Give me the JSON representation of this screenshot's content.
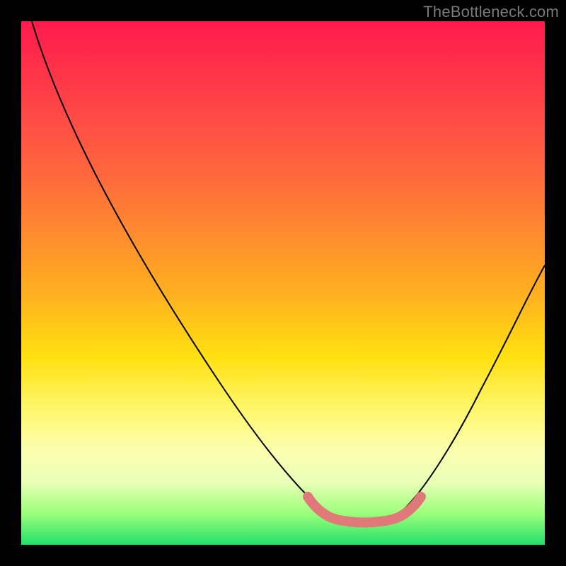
{
  "watermark": "TheBottleneck.com",
  "chart_data": {
    "type": "line",
    "title": "",
    "xlabel": "",
    "ylabel": "",
    "xlim": [
      0,
      100
    ],
    "ylim": [
      0,
      100
    ],
    "series": [
      {
        "name": "bottleneck-curve",
        "x": [
          2,
          10,
          20,
          30,
          40,
          50,
          55,
          62,
          68,
          72,
          78,
          85,
          92,
          100
        ],
        "values": [
          99,
          85,
          70,
          55,
          40,
          25,
          12,
          6,
          6,
          6,
          12,
          25,
          38,
          52
        ]
      }
    ],
    "highlight": {
      "name": "optimal-band",
      "color": "#e07a7a",
      "x": [
        55,
        58,
        62,
        66,
        70,
        74,
        77
      ],
      "values": [
        11,
        8,
        6,
        6,
        6,
        8,
        11
      ]
    }
  }
}
